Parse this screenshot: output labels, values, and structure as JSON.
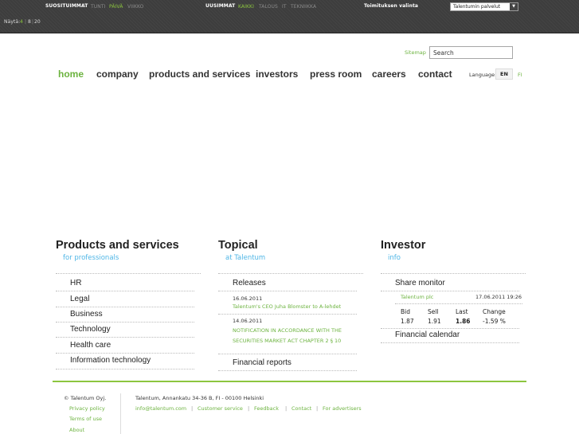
{
  "topbar": {
    "popular_label": "SUOSITUIMMAT",
    "popular_tabs": [
      "TUNTI",
      "PÄIVÄ",
      "VIIKKO"
    ],
    "latest_label": "UUSIMMAT",
    "latest_tabs": [
      "KAIKKI",
      "TALOUS",
      "IT",
      "TEKNIIKKA"
    ],
    "editor_label": "Toimituksen valinta",
    "select_value": "Talentumin palvelut",
    "show_label": "Näytä:",
    "show_options": [
      "4",
      "8",
      "20"
    ],
    "colors": {
      "bar_bg": "#3d3d3d",
      "active": "#8cc63f"
    }
  },
  "header": {
    "sitemap": "Sitemap",
    "search_value": "Search",
    "language_label": "Language:",
    "lang_en": "EN",
    "lang_fi": "FI"
  },
  "nav": {
    "items": [
      "home",
      "company",
      "products and services",
      "investors",
      "press room",
      "careers",
      "contact"
    ],
    "active": "home"
  },
  "products": {
    "title": "Products and services",
    "subtitle": "for professionals",
    "items": [
      "HR",
      "Legal",
      "Business",
      "Technology",
      "Health care",
      "Information technology"
    ]
  },
  "topical": {
    "title": "Topical",
    "subtitle": "at Talentum",
    "releases_label": "Releases",
    "news": [
      {
        "date": "16.06.2011",
        "text": "Talentum's CEO Juha Blomster to A-lehdet"
      },
      {
        "date": "14.06.2011",
        "text_line1": "NOTIFICATION IN ACCORDANCE WITH THE",
        "text_line2": "SECURITIES MARKET ACT CHAPTER 2 § 10"
      }
    ],
    "financial_reports": "Financial reports"
  },
  "investor": {
    "title": "Investor",
    "subtitle": "info",
    "share_monitor": "Share monitor",
    "company": "Talentum plc",
    "timestamp": "17.06.2011 19:26",
    "headers": [
      "Bid",
      "Sell",
      "Last",
      "Change"
    ],
    "values": [
      "1.87",
      "1.91",
      "1.86",
      "-1.59 %"
    ],
    "financial_calendar": "Financial calendar"
  },
  "footer": {
    "copyright": "© Talentum Oyj.",
    "links_left": [
      "Privacy policy",
      "Terms of use",
      "About"
    ],
    "address": "Talentum, Annankatu 34-36 B, FI - 00100 Helsinki",
    "links_right": [
      "info@talentum.com",
      "Customer service",
      "Feedback",
      "Contact",
      "For advertisers"
    ],
    "colors": {
      "rule": "#8cc63f",
      "link": "#6cb33f",
      "sub": "#4fb6e6"
    }
  }
}
